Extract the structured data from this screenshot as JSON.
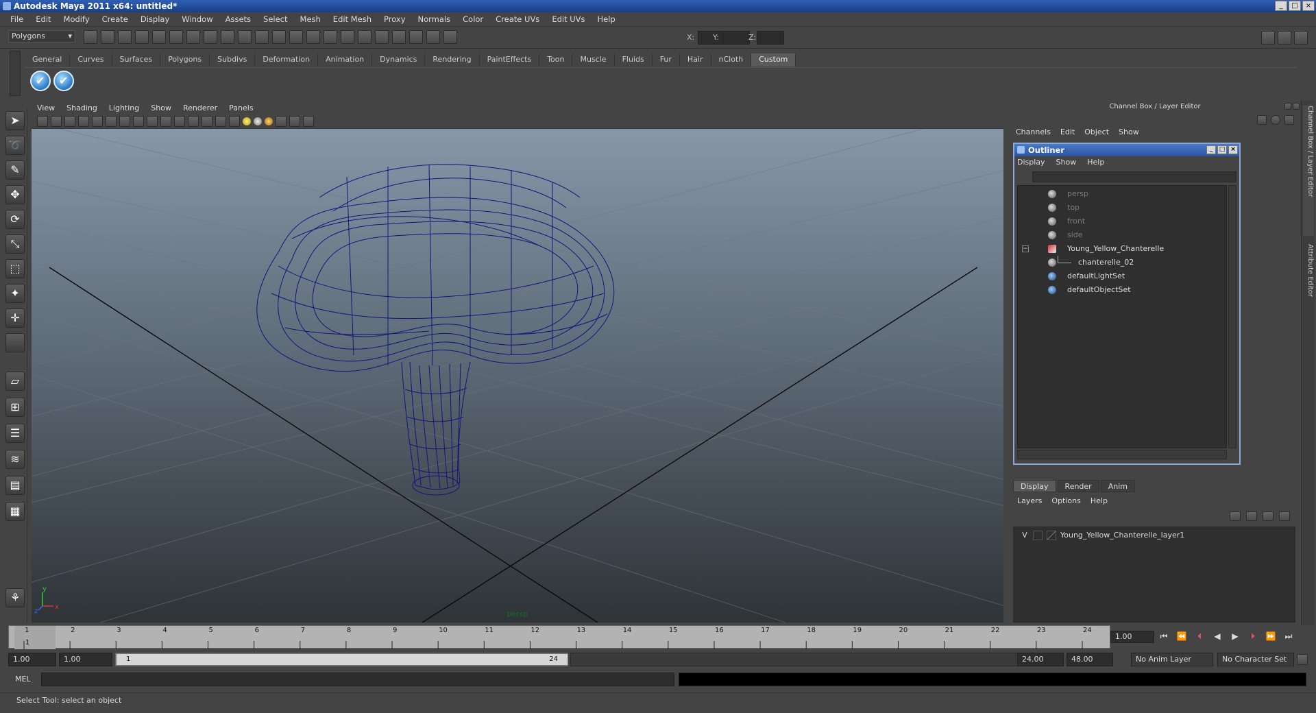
{
  "window": {
    "title": "Autodesk Maya 2011 x64: untitled*",
    "buttons": [
      "_",
      "□",
      "×"
    ]
  },
  "menubar": [
    "File",
    "Edit",
    "Modify",
    "Create",
    "Display",
    "Window",
    "Assets",
    "Select",
    "Mesh",
    "Edit Mesh",
    "Proxy",
    "Normals",
    "Color",
    "Create UVs",
    "Edit UVs",
    "Help"
  ],
  "statusline": {
    "menu_set": "Polygons",
    "x_label": "X:",
    "y_label": "Y:",
    "z_label": "Z:"
  },
  "shelf": {
    "tabs": [
      "General",
      "Curves",
      "Surfaces",
      "Polygons",
      "Subdivs",
      "Deformation",
      "Animation",
      "Dynamics",
      "Rendering",
      "PaintEffects",
      "Toon",
      "Muscle",
      "Fluids",
      "Fur",
      "Hair",
      "nCloth",
      "Custom"
    ],
    "active": "Custom"
  },
  "viewport": {
    "menu": [
      "View",
      "Shading",
      "Lighting",
      "Show",
      "Renderer",
      "Panels"
    ],
    "camera": "persp",
    "axis_x": "x",
    "axis_y": "y",
    "axis_z": "z"
  },
  "channelbox": {
    "title": "Channel Box / Layer Editor",
    "menu": [
      "Channels",
      "Edit",
      "Object",
      "Show"
    ]
  },
  "outliner": {
    "title": "Outliner",
    "menu": [
      "Display",
      "Show",
      "Help"
    ],
    "items": [
      {
        "label": "persp",
        "dim": true
      },
      {
        "label": "top",
        "dim": true
      },
      {
        "label": "front",
        "dim": true
      },
      {
        "label": "side",
        "dim": true
      },
      {
        "label": "Young_Yellow_Chanterelle",
        "dim": false
      },
      {
        "label": "chanterelle_02",
        "dim": false
      },
      {
        "label": "defaultLightSet",
        "dim": false
      },
      {
        "label": "defaultObjectSet",
        "dim": false
      }
    ]
  },
  "layers": {
    "tabs": [
      "Display",
      "Render",
      "Anim"
    ],
    "active": "Display",
    "menu": [
      "Layers",
      "Options",
      "Help"
    ],
    "row": {
      "visible": "V",
      "name": "Young_Yellow_Chanterelle_layer1"
    }
  },
  "side_tabs": [
    "Channel Box / Layer Editor",
    "Attribute Editor"
  ],
  "timeline": {
    "frames": [
      "1",
      "2",
      "3",
      "4",
      "5",
      "6",
      "7",
      "8",
      "9",
      "10",
      "11",
      "12",
      "13",
      "14",
      "15",
      "16",
      "17",
      "18",
      "19",
      "20",
      "21",
      "22",
      "23",
      "24"
    ],
    "current_frame_label": "1",
    "current_frame": "1.00"
  },
  "range": {
    "start": "1.00",
    "start2": "1.00",
    "handle_start": "1",
    "handle_end": "24",
    "end": "24.00",
    "end2": "48.00",
    "anim_layer": "No Anim Layer",
    "character_set": "No Character Set"
  },
  "cmd": {
    "label": "MEL"
  },
  "help": {
    "text": "Select Tool: select an object"
  }
}
